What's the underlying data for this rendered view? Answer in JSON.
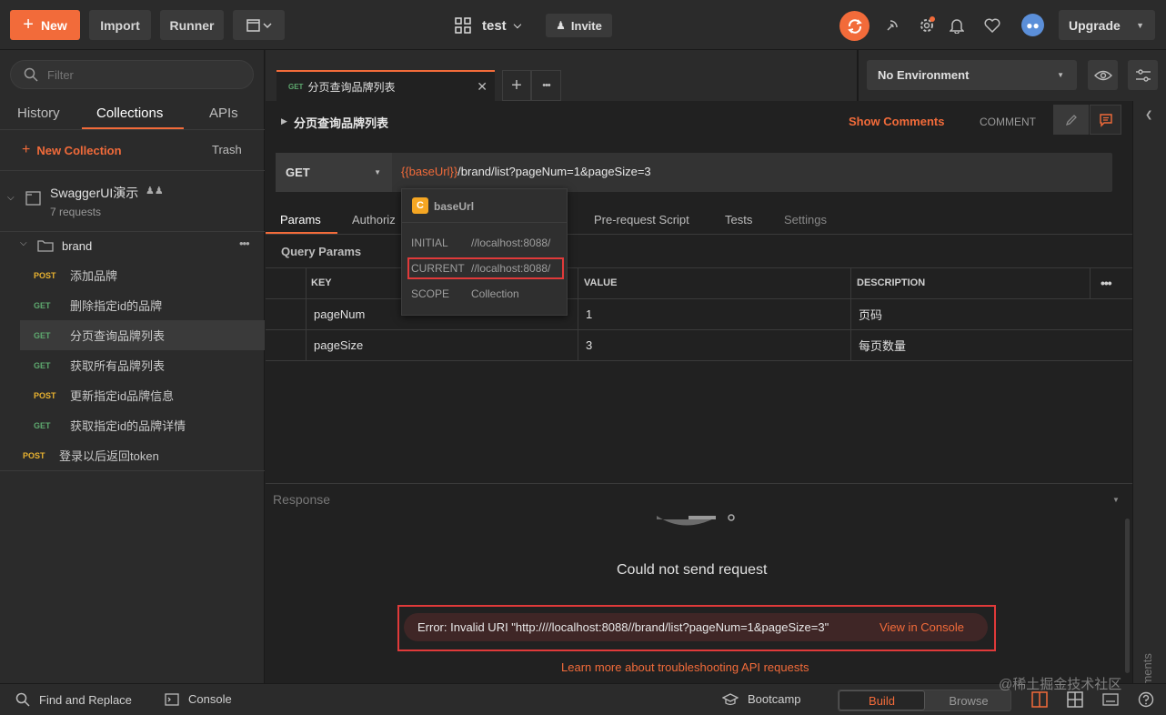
{
  "topbar": {
    "new_label": "New",
    "import_label": "Import",
    "runner_label": "Runner",
    "workspace_name": "test",
    "invite_label": "Invite",
    "upgrade_label": "Upgrade"
  },
  "sidebar": {
    "filter_placeholder": "Filter",
    "tabs": [
      "History",
      "Collections",
      "APIs"
    ],
    "new_collection_label": "New Collection",
    "trash_label": "Trash",
    "collection": {
      "name": "SwaggerUI演示",
      "count": "7 requests"
    },
    "folder": {
      "name": "brand"
    },
    "requests": [
      {
        "method": "POST",
        "name": "添加品牌"
      },
      {
        "method": "GET",
        "name": "删除指定id的品牌"
      },
      {
        "method": "GET",
        "name": "分页查询品牌列表"
      },
      {
        "method": "GET",
        "name": "获取所有品牌列表"
      },
      {
        "method": "POST",
        "name": "更新指定id品牌信息"
      },
      {
        "method": "GET",
        "name": "获取指定id的品牌详情"
      }
    ],
    "root_request": {
      "method": "POST",
      "name": "登录以后返回token"
    }
  },
  "tab": {
    "method": "GET",
    "title": "分页查询品牌列表"
  },
  "environment": {
    "selected": "No Environment"
  },
  "request": {
    "title": "分页查询品牌列表",
    "show_comments": "Show Comments",
    "comment_label": "COMMENT",
    "method": "GET",
    "url_var": "{{baseUrl}}",
    "url_rest": "/brand/list?pageNum=1&pageSize=3",
    "subtabs": {
      "params": "Params",
      "auth": "Authoriz",
      "prereq": "Pre-request Script",
      "tests": "Tests",
      "settings": "Settings"
    },
    "query_params_label": "Query Params",
    "columns": {
      "key": "KEY",
      "value": "VALUE",
      "description": "DESCRIPTION"
    },
    "rows": [
      {
        "key": "pageNum",
        "value": "1",
        "description": "页码"
      },
      {
        "key": "pageSize",
        "value": "3",
        "description": "每页数量"
      }
    ]
  },
  "variable_popup": {
    "badge": "C",
    "name": "baseUrl",
    "initial_label": "INITIAL",
    "initial_value": "//localhost:8088/",
    "current_label": "CURRENT",
    "current_value": "//localhost:8088/",
    "scope_label": "SCOPE",
    "scope_value": "Collection"
  },
  "response": {
    "label": "Response",
    "message": "Could not send request",
    "error": "Error: Invalid URI \"http:////localhost:8088//brand/list?pageNum=1&pageSize=3\"",
    "view_console": "View in Console",
    "learn_more": "Learn more about troubleshooting API requests"
  },
  "comments_side_label": "Comments",
  "bottombar": {
    "find_replace": "Find and Replace",
    "console": "Console",
    "bootcamp": "Bootcamp",
    "build": "Build",
    "browse": "Browse"
  },
  "watermark": "@稀土掘金技术社区",
  "colors": {
    "accent": "#f26b3a",
    "get": "#5ea96f",
    "post": "#e8b230",
    "error_border": "#e03a3a"
  }
}
